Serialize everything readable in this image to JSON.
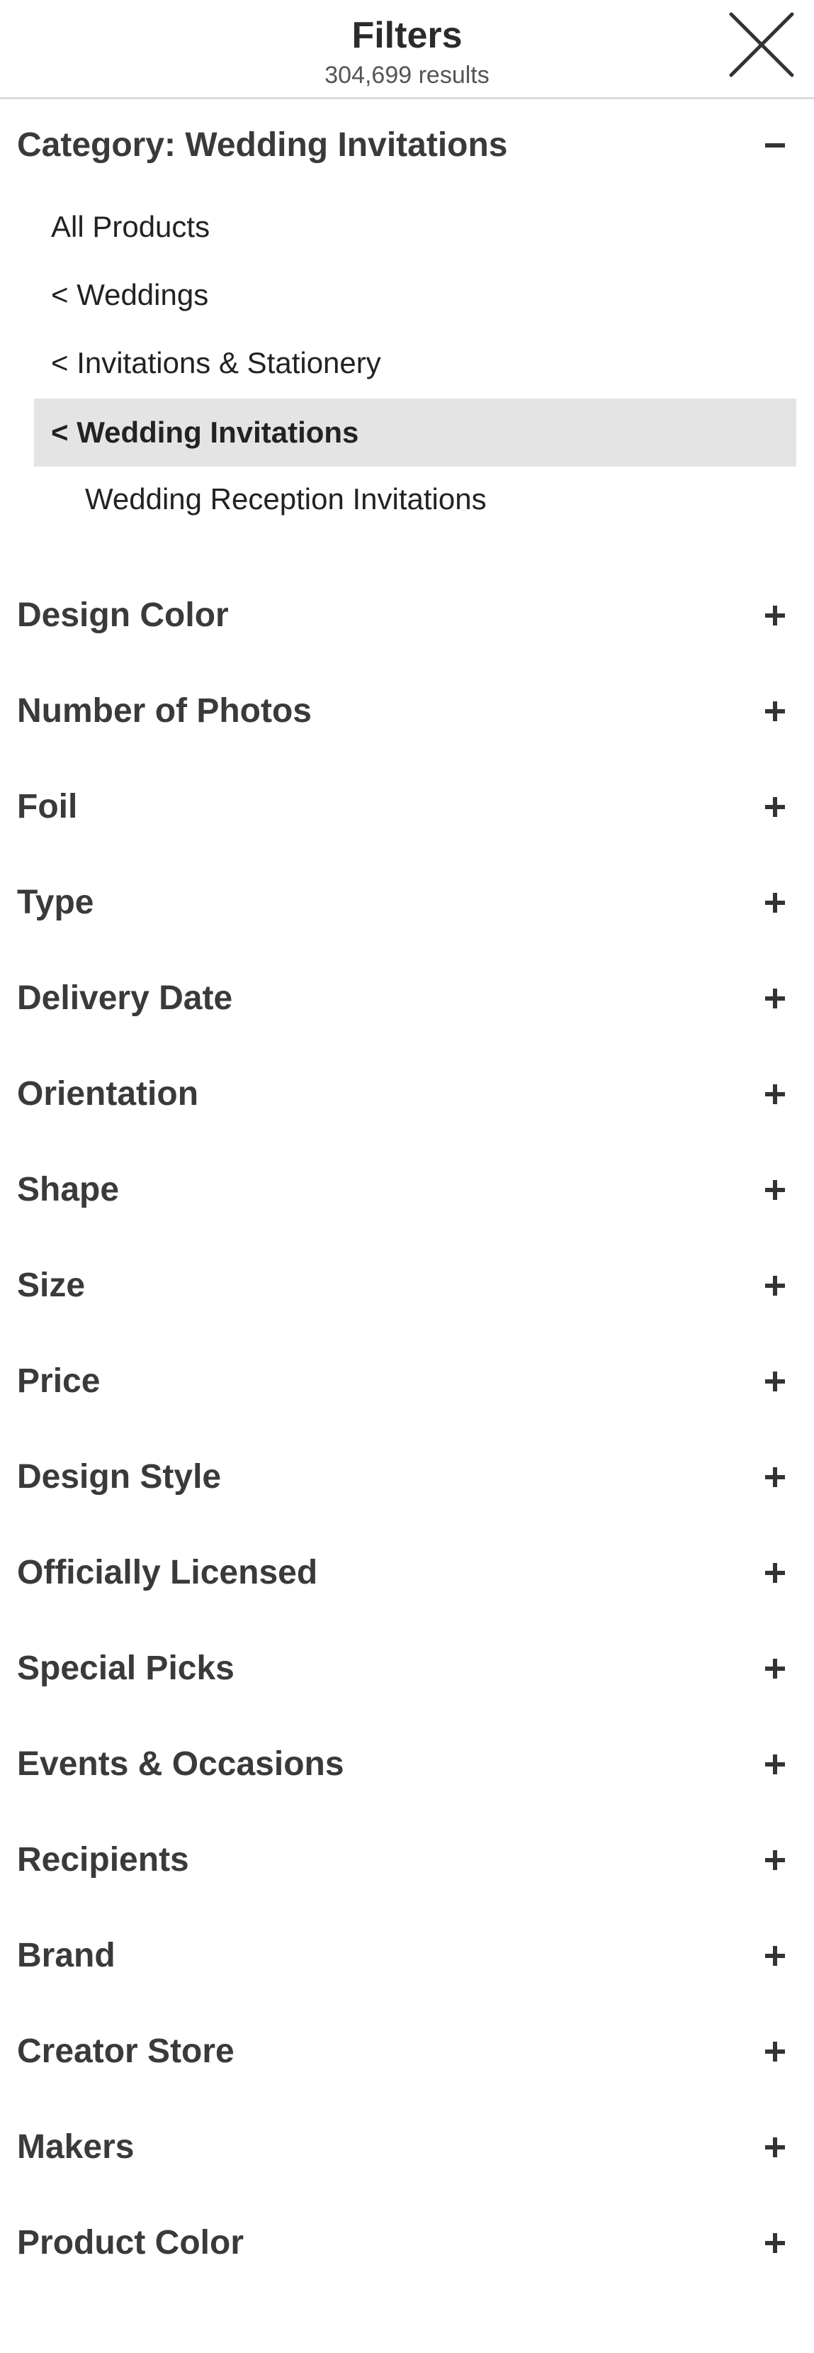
{
  "header": {
    "title": "Filters",
    "results": "304,699 results",
    "close_icon": "close-icon"
  },
  "category": {
    "label": "Category: Wedding Invitations",
    "toggle_icon": "minus-icon",
    "items": [
      {
        "label": "All Products"
      },
      {
        "label": "< Weddings"
      },
      {
        "label": "< Invitations & Stationery"
      },
      {
        "label": "< Wedding Invitations",
        "selected": true
      },
      {
        "label": "Wedding Reception Invitations"
      }
    ]
  },
  "filters": [
    {
      "label": "Design Color",
      "toggle_icon": "plus-icon"
    },
    {
      "label": "Number of Photos",
      "toggle_icon": "plus-icon"
    },
    {
      "label": "Foil",
      "toggle_icon": "plus-icon"
    },
    {
      "label": "Type",
      "toggle_icon": "plus-icon"
    },
    {
      "label": "Delivery Date",
      "toggle_icon": "plus-icon"
    },
    {
      "label": "Orientation",
      "toggle_icon": "plus-icon"
    },
    {
      "label": "Shape",
      "toggle_icon": "plus-icon"
    },
    {
      "label": "Size",
      "toggle_icon": "plus-icon"
    },
    {
      "label": "Price",
      "toggle_icon": "plus-icon"
    },
    {
      "label": "Design Style",
      "toggle_icon": "plus-icon"
    },
    {
      "label": "Officially Licensed",
      "toggle_icon": "plus-icon"
    },
    {
      "label": "Special Picks",
      "toggle_icon": "plus-icon"
    },
    {
      "label": "Events & Occasions",
      "toggle_icon": "plus-icon"
    },
    {
      "label": "Recipients",
      "toggle_icon": "plus-icon"
    },
    {
      "label": "Brand",
      "toggle_icon": "plus-icon"
    },
    {
      "label": "Creator Store",
      "toggle_icon": "plus-icon"
    },
    {
      "label": "Makers",
      "toggle_icon": "plus-icon"
    },
    {
      "label": "Product Color",
      "toggle_icon": "plus-icon"
    }
  ],
  "colors": {
    "text": "#3a3a3a",
    "selected_bg": "#e4e4e4",
    "divider": "#dcdcdc"
  }
}
